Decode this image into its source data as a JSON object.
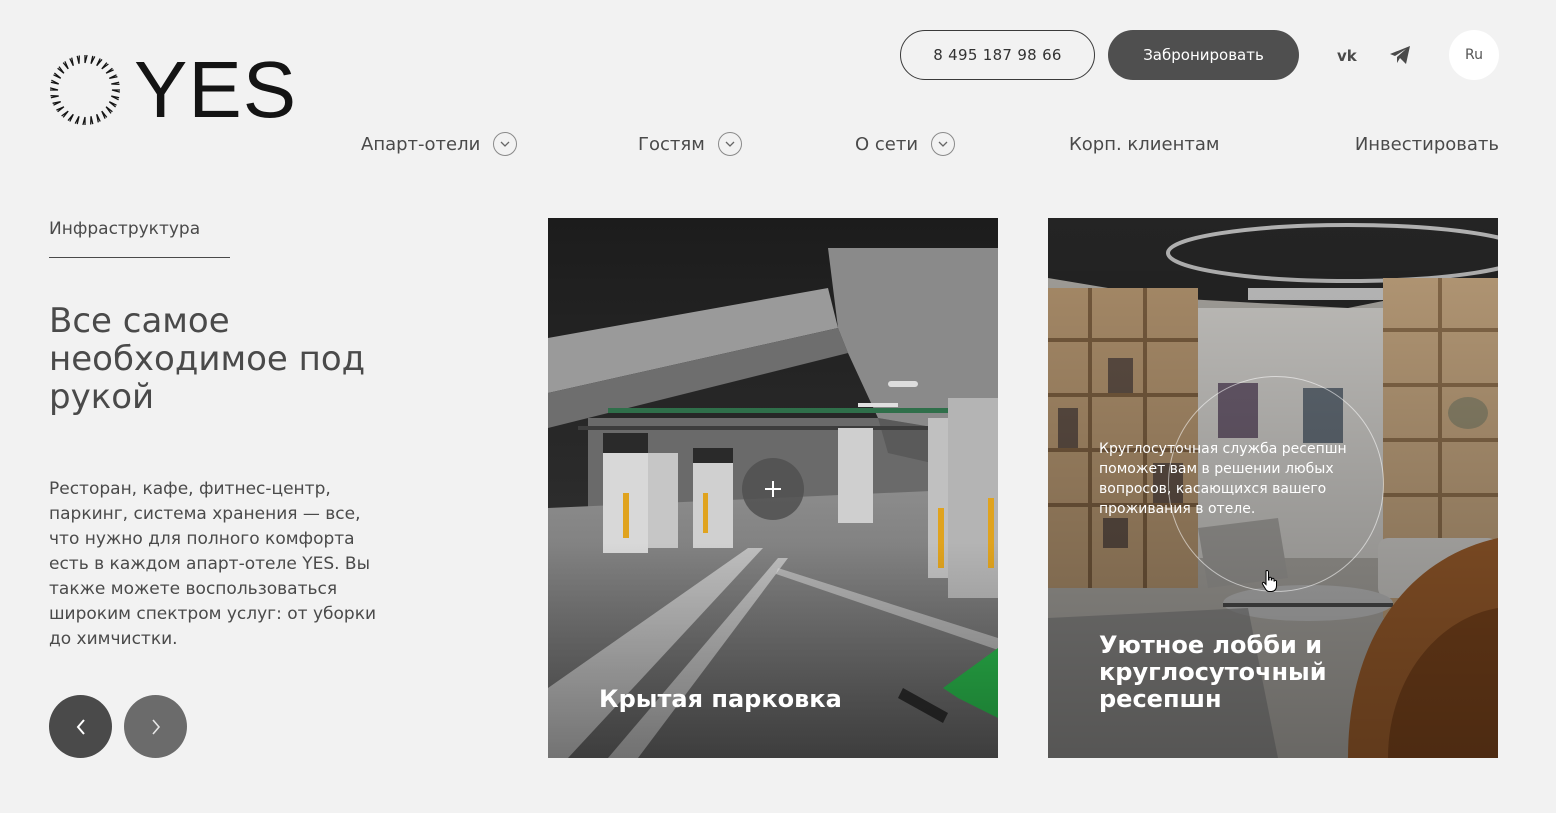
{
  "header": {
    "logo_text": "YES",
    "phone": "8 495 187 98 66",
    "book_label": "Забронировать",
    "lang": "Ru"
  },
  "nav": {
    "items": [
      {
        "label": "Апарт-отели",
        "has_dropdown": true
      },
      {
        "label": "Гостям",
        "has_dropdown": true
      },
      {
        "label": "О сети",
        "has_dropdown": true
      },
      {
        "label": "Корп. клиентам",
        "has_dropdown": false
      },
      {
        "label": "Инвестировать",
        "has_dropdown": false
      }
    ]
  },
  "section": {
    "label": "Инфраструктура",
    "heading": "Все самое необходимое под рукой",
    "description": "Ресторан, кафе, фитнес-центр, паркинг, система хранения — все, что нужно для полного комфорта есть в каждом апарт-отеле YES. Вы также можете воспользоваться широким спектром услуг: от уборки до химчистки."
  },
  "cards": [
    {
      "title": "Крытая парковка"
    },
    {
      "title": "Уютное лобби и круглосуточный ресепшн",
      "info": "Круглосуточная служба ресепшн поможет вам в решении любых вопросов, касающихся вашего проживания в отеле."
    }
  ],
  "icons": {
    "logo": "sunburst-ring-icon",
    "social_1": "vk-icon",
    "social_2": "telegram-icon",
    "dropdown": "chevron-down-icon",
    "prev": "chevron-left-icon",
    "next": "chevron-right-icon",
    "expand": "plus-icon",
    "cursor": "hand-cursor-icon"
  },
  "colors": {
    "background": "#f2f2f2",
    "text": "#4a4a4a",
    "button_dark": "#4f4f4f",
    "logo": "#141414"
  }
}
